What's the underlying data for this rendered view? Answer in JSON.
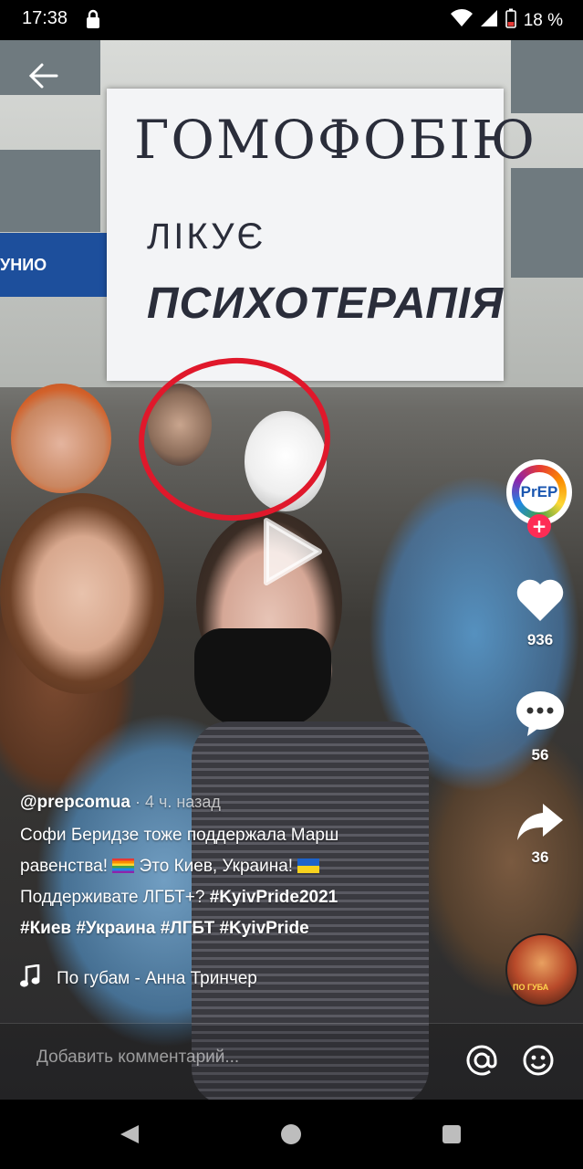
{
  "status_bar": {
    "time": "17:38",
    "battery": "18 %"
  },
  "sign": {
    "line1": "ГОМОФОБІЮ",
    "line2": "ЛІКУЄ",
    "line3": "ПСИХОТЕРАПІЯ"
  },
  "background": {
    "shop_sign": "УНИО"
  },
  "profile": {
    "avatar_label": "PrEP"
  },
  "actions": {
    "likes": "936",
    "comments": "56",
    "shares": "36"
  },
  "caption": {
    "author": "@prepcomua",
    "time": " · 4 ч. назад",
    "text_1": "Софи Беридзе тоже поддержала Марш равенства!",
    "text_2": " Это Киев, Украина!",
    "text_3": "Поддерживате ЛГБТ+? ",
    "tags_1": "#KyivPride2021",
    "tags_2": "#Киев #Украина #ЛГБТ #KyivPride"
  },
  "music": {
    "title": "По губам - Анна Тринчер",
    "disc_text": "ПО ГУБА"
  },
  "comment": {
    "placeholder": "Добавить комментарий..."
  },
  "colors": {
    "accent": "#fe2c55",
    "highlight_circle": "#e0182b"
  }
}
